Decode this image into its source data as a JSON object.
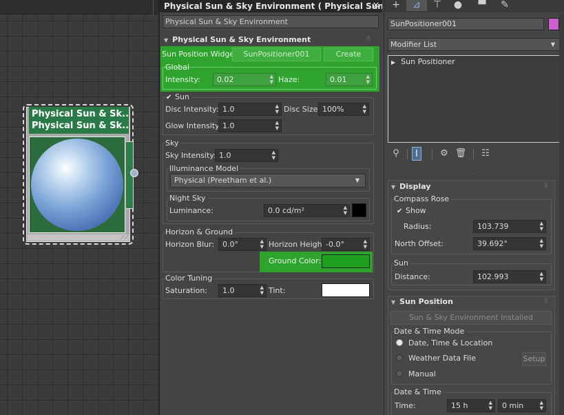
{
  "node": {
    "title_line1": "Physical Sun & Sk...",
    "title_line2": "Physical Sun & Sk..."
  },
  "mid_panel": {
    "window_title": "Physical Sun & Sky Environment  ( Physical Sun...",
    "close_glyph": "✕",
    "name_field": "Physical Sun & Sky Environment",
    "rollout_title": "Physical Sun & Sky Environment",
    "sun_position_widget_label": "Sun Position Widget:",
    "widget_button": "SunPositioner001",
    "create_button": "Create",
    "global": {
      "title": "Global",
      "intensity_label": "Intensity:",
      "intensity_value": "0.02",
      "haze_label": "Haze:",
      "haze_value": "0.01"
    },
    "sun": {
      "title": "Sun",
      "checked": true,
      "disc_intensity_label": "Disc Intensity:",
      "disc_intensity_value": "1.0",
      "disc_size_label": "Disc Size:",
      "disc_size_value": "100%",
      "glow_intensity_label": "Glow Intensity:",
      "glow_intensity_value": "1.0"
    },
    "sky": {
      "title": "Sky",
      "sky_intensity_label": "Sky Intensity:",
      "sky_intensity_value": "1.0",
      "illuminance_model_title": "Illuminance Model",
      "illuminance_model_value": "Physical (Preetham et al.)",
      "night_sky_title": "Night Sky",
      "luminance_label": "Luminance:",
      "luminance_value": "0.0 cd/m²",
      "luminance_color": "#000000"
    },
    "horizon": {
      "title": "Horizon & Ground",
      "blur_label": "Horizon Blur:",
      "blur_value": "0.0°",
      "height_label": "Horizon Height:",
      "height_value": "-0.0°",
      "ground_color_label": "Ground Color:",
      "ground_color": "#1ea01e"
    },
    "color_tuning": {
      "title": "Color Tuning",
      "saturation_label": "Saturation:",
      "saturation_value": "1.0",
      "tint_label": "Tint:",
      "tint_color": "#ffffff"
    }
  },
  "right_panel": {
    "tabs": [
      {
        "icon": "plus-icon",
        "glyph": "+"
      },
      {
        "icon": "modify-icon",
        "glyph": "⊿"
      },
      {
        "icon": "hierarchy-icon",
        "glyph": "⊤"
      },
      {
        "icon": "motion-icon",
        "glyph": "●"
      },
      {
        "icon": "display-icon",
        "glyph": "▀"
      },
      {
        "icon": "utilities-icon",
        "glyph": "✎"
      }
    ],
    "object_name": "SunPositioner001",
    "object_color": "#cb5fcb",
    "modifier_list": "Modifier List",
    "stack_item": "Sun Positioner",
    "display": {
      "title": "Display",
      "compass_rose_title": "Compass Rose",
      "show_label": "Show",
      "show_checked": true,
      "radius_label": "Radius:",
      "radius_value": "103.739",
      "north_offset_label": "North Offset:",
      "north_offset_value": "39.692°",
      "sun_title": "Sun",
      "distance_label": "Distance:",
      "distance_value": "102.993"
    },
    "sun_position": {
      "title": "Sun Position",
      "installed_button": "Sun & Sky Environment Installed",
      "mode_title": "Date & Time Mode",
      "mode_options": [
        "Date, Time & Location",
        "Weather Data File",
        "Manual"
      ],
      "selected_mode": 0,
      "setup_button": "Setup",
      "date_time_title": "Date & Time",
      "time_label": "Time:",
      "hours_value": "15 h",
      "minutes_value": "0 min"
    }
  },
  "glyphs": {
    "spinner": "▲▼",
    "dropdown_arrow": "▼",
    "rollout_open": "▼",
    "rollout_closed": "▶",
    "grip": "⠿",
    "check": "✔"
  }
}
